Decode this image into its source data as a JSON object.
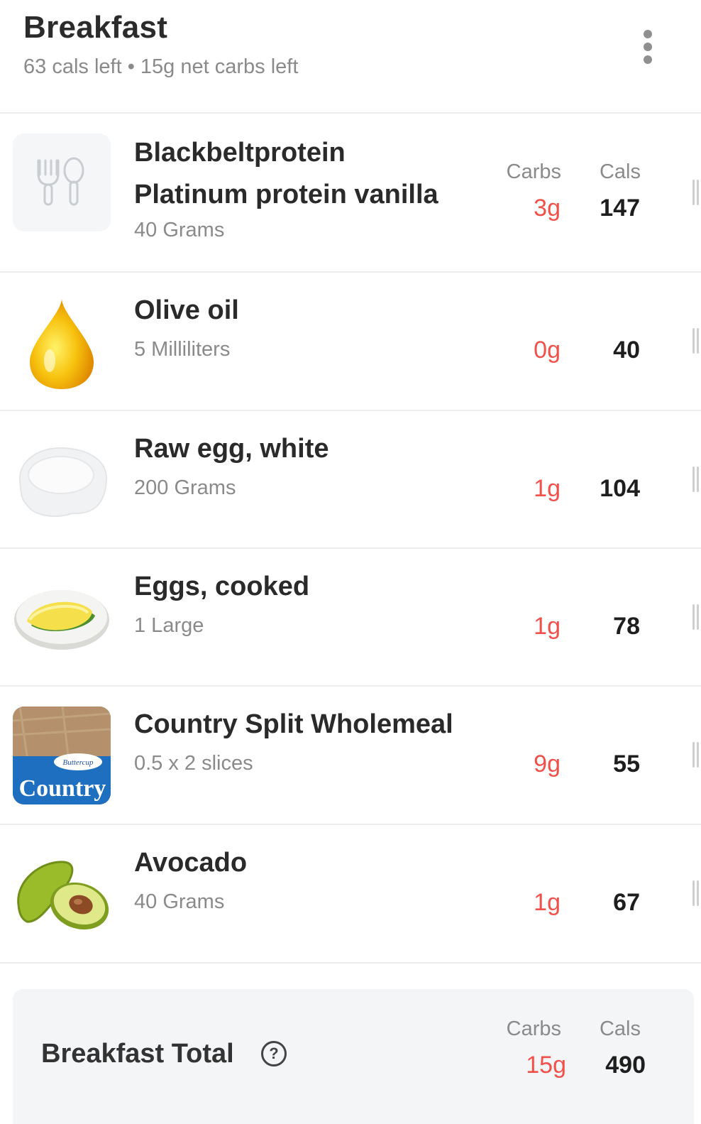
{
  "header": {
    "title": "Breakfast",
    "cals_left": "63 cals left",
    "separator": "•",
    "carbs_left": "15g net carbs left"
  },
  "columns": {
    "carbs": "Carbs",
    "cals": "Cals"
  },
  "foods": [
    {
      "name_line1": "Blackbeltprotein",
      "name_line2": "Platinum protein vanilla",
      "serving": "40 Grams",
      "carbs": "3g",
      "cals": "147",
      "icon": "fork-spoon-placeholder-icon"
    },
    {
      "name_line1": "Olive oil",
      "serving": "5 Milliliters",
      "carbs": "0g",
      "cals": "40",
      "icon": "oil-drop-icon"
    },
    {
      "name_line1": "Raw egg, white",
      "serving": "200 Grams",
      "carbs": "1g",
      "cals": "104",
      "icon": "egg-white-icon"
    },
    {
      "name_line1": "Eggs, cooked",
      "serving": "1 Large",
      "carbs": "1g",
      "cals": "78",
      "icon": "omelette-plate-icon"
    },
    {
      "name_line1": "Country Split Wholemeal",
      "serving": "0.5 x 2 slices",
      "carbs": "9g",
      "cals": "55",
      "icon": "bread-package-icon",
      "package_brand": "Buttercup",
      "package_text": "Country"
    },
    {
      "name_line1": "Avocado",
      "serving": "40 Grams",
      "carbs": "1g",
      "cals": "67",
      "icon": "avocado-icon"
    }
  ],
  "total": {
    "label": "Breakfast Total",
    "help": "?",
    "carbs_label": "Carbs",
    "cals_label": "Cals",
    "carbs": "15g",
    "cals": "490"
  },
  "colors": {
    "carbs": "#f0514a",
    "divider": "#ececec",
    "total_bg": "#f4f5f7"
  }
}
